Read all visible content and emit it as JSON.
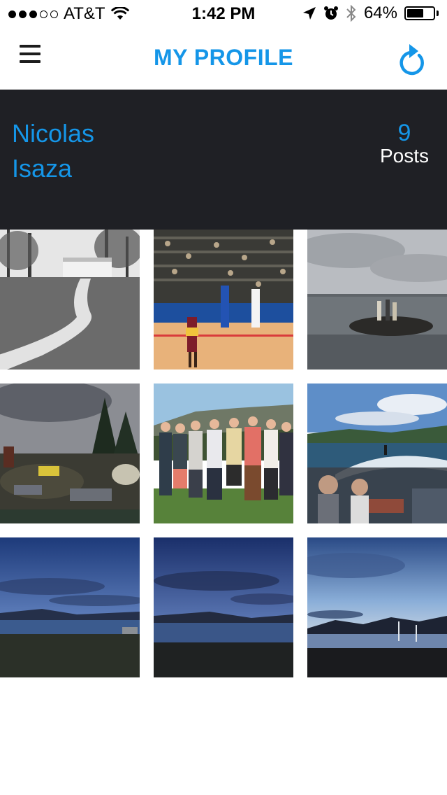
{
  "status_bar": {
    "carrier": "AT&T",
    "time": "1:42 PM",
    "battery_percent": "64%",
    "battery_level": 0.64,
    "signal_bars_filled": 3,
    "signal_bars_total": 5,
    "icons": [
      "wifi-icon",
      "location-arrow-icon",
      "alarm-icon",
      "bluetooth-icon",
      "battery-icon"
    ]
  },
  "nav": {
    "title": "MY PROFILE",
    "left_icon": "hamburger-menu-icon",
    "right_icon": "refresh-icon",
    "accent_color": "#1596e8"
  },
  "profile": {
    "first_name": "Nicolas",
    "last_name": "Isaza",
    "posts_count": "9",
    "posts_label": "Posts",
    "header_bg": "#1f2025"
  },
  "photos": [
    {
      "subject": "black and white path through park"
    },
    {
      "subject": "basketball game"
    },
    {
      "subject": "people on rocks in lake"
    },
    {
      "subject": "campsite with gear"
    },
    {
      "subject": "group of friends"
    },
    {
      "subject": "wakeboarding behind boat"
    },
    {
      "subject": "lake at dusk"
    },
    {
      "subject": "lake at dusk"
    },
    {
      "subject": "lake sunset silhouette"
    }
  ]
}
